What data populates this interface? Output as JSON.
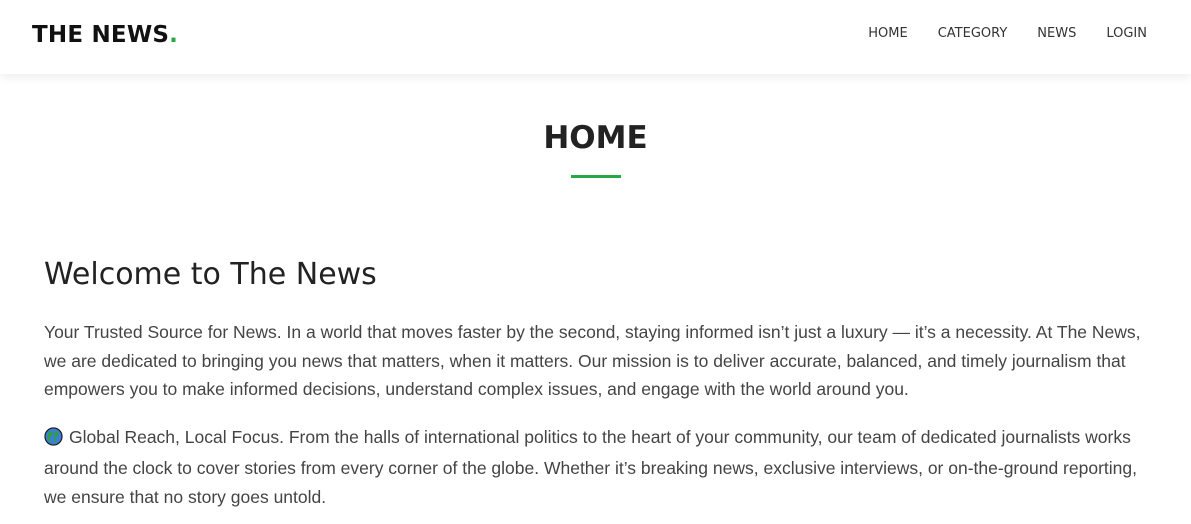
{
  "brand": {
    "name": "THE NEWS",
    "dot": ".",
    "accent_color": "#28a745"
  },
  "nav": {
    "items": [
      {
        "label": "HOME"
      },
      {
        "label": "CATEGORY"
      },
      {
        "label": "NEWS"
      },
      {
        "label": "LOGIN"
      }
    ]
  },
  "page": {
    "title": "HOME"
  },
  "content": {
    "heading": "Welcome to The News",
    "paragraph1": "Your Trusted Source for News. In a world that moves faster by the second, staying informed isn’t just a luxury — it’s a necessity. At The News, we are dedicated to bringing you news that matters, when it matters. Our mission is to deliver accurate, balanced, and timely journalism that empowers you to make informed decisions, understand complex issues, and engage with the world around you.",
    "paragraph2_icon": "globe-icon",
    "paragraph2": "Global Reach, Local Focus. From the halls of international politics to the heart of your community, our team of dedicated journalists works around the clock to cover stories from every corner of the globe. Whether it’s breaking news, exclusive interviews, or on-the-ground reporting, we ensure that no story goes untold."
  }
}
